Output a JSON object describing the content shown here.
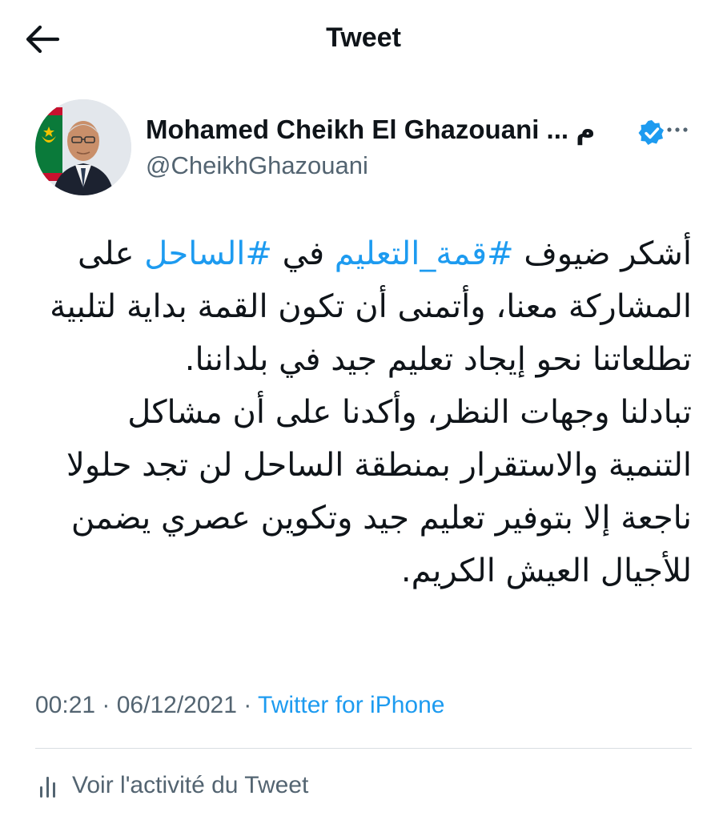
{
  "header": {
    "back_icon": "arrow-left-icon",
    "title": "Tweet"
  },
  "author": {
    "display_name": "Mohamed Cheikh El Ghazouani ... م",
    "handle": "@CheikhGhazouani",
    "verified_icon": "verified-badge-icon",
    "more_icon": "more-options-icon"
  },
  "tweet": {
    "line1_before": "أشكر ضيوف ",
    "hashtag1": "#قمة_التعليم",
    "line1_middle": " في ",
    "hashtag2": "#الساحل",
    "line1_after": " على المشاركة معنا، وأتمنى أن تكون القمة بداية لتلبية تطلعاتنا نحو إيجاد تعليم جيد في بلداننا.",
    "paragraph2": "تبادلنا وجهات النظر، وأكدنا على أن مشاكل التنمية والاستقرار بمنطقة الساحل لن تجد حلولا ناجعة إلا بتوفير تعليم جيد وتكوين عصري يضمن للأجيال العيش الكريم."
  },
  "meta": {
    "time": "00:21",
    "separator": " · ",
    "date": "06/12/2021",
    "source": "Twitter for iPhone"
  },
  "activity": {
    "icon": "analytics-bars-icon",
    "label": "Voir l'activité du Tweet"
  },
  "colors": {
    "accent": "#1d9bf0",
    "secondary_text": "#536471",
    "primary_text": "#0f1419",
    "divider": "#d9dee2"
  }
}
